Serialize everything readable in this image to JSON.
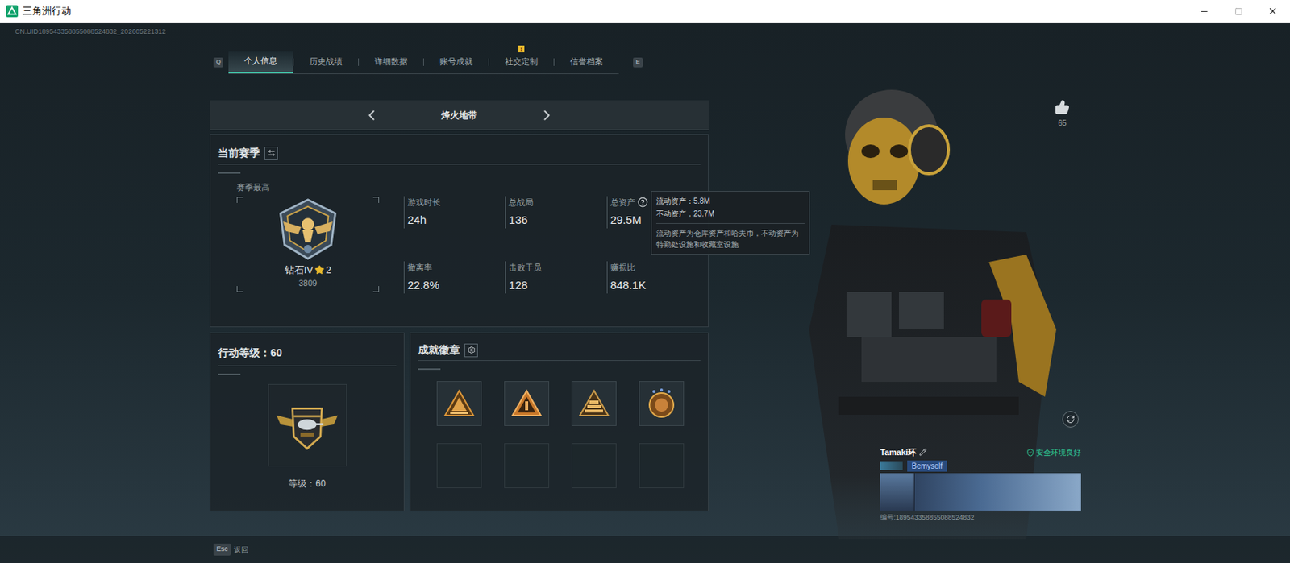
{
  "window": {
    "title": "三角洲行动"
  },
  "uid": "CN.UID189543358855088524832_202605221312",
  "tabs": {
    "prev_key": "Q",
    "next_key": "E",
    "items": [
      {
        "label": "个人信息",
        "selected": true
      },
      {
        "label": "历史战绩",
        "selected": false
      },
      {
        "label": "详细数据",
        "selected": false
      },
      {
        "label": "账号成就",
        "selected": false
      },
      {
        "label": "社交定制",
        "selected": false,
        "badge": "!"
      },
      {
        "label": "信誉档案",
        "selected": false
      }
    ]
  },
  "mode": {
    "label": "烽火地带"
  },
  "season": {
    "title": "当前赛季",
    "best_label": "赛季最高",
    "rank": "钻石IV",
    "rank_stars": "2",
    "score": "3809",
    "stats": [
      {
        "label": "游戏时长",
        "value": "24h",
        "help": false
      },
      {
        "label": "总战局",
        "value": "136",
        "help": false
      },
      {
        "label": "总资产",
        "value": "29.5M",
        "help": true
      },
      {
        "label": "撤离率",
        "value": "22.8%",
        "help": false
      },
      {
        "label": "击败干员",
        "value": "128",
        "help": false
      },
      {
        "label": "赚损比",
        "value": "848.1K",
        "help": false
      }
    ]
  },
  "tooltip": {
    "lines": [
      "流动资产：5.8M",
      "不动资产：23.7M"
    ],
    "note": "流动资产为仓库资产和哈夫币，不动资产为特勤处设施和收藏室设施"
  },
  "level": {
    "title": "行动等级：60",
    "label": "等级：60"
  },
  "achievements": {
    "title": "成就徽章",
    "slots": [
      {
        "kind": "pyramid"
      },
      {
        "kind": "rank-one"
      },
      {
        "kind": "bars"
      },
      {
        "kind": "shield"
      },
      {
        "kind": "empty"
      },
      {
        "kind": "empty"
      },
      {
        "kind": "empty"
      },
      {
        "kind": "empty"
      }
    ]
  },
  "footer": {
    "key": "Esc",
    "label": "返回"
  },
  "likes": "65",
  "player": {
    "name": "Tamaki环",
    "status": "安全环境良好",
    "tag": "Bemyself",
    "id": "编号:189543358855088524832"
  }
}
